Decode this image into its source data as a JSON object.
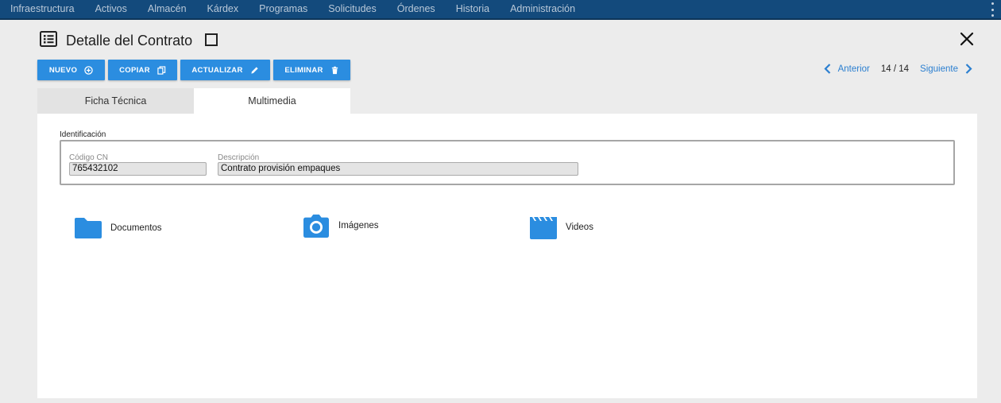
{
  "nav": {
    "items": [
      "Infraestructura",
      "Activos",
      "Almacén",
      "Kárdex",
      "Programas",
      "Solicitudes",
      "Órdenes",
      "Historia",
      "Administración"
    ]
  },
  "header": {
    "title": "Detalle del Contrato"
  },
  "toolbar": {
    "nuevo": "NUEVO",
    "copiar": "COPIAR",
    "actualizar": "ACTUALIZAR",
    "eliminar": "ELIMINAR"
  },
  "pager": {
    "prev": "Anterior",
    "count": "14 / 14",
    "next": "Siguiente"
  },
  "tabs": [
    {
      "label": "Ficha Técnica",
      "active": false
    },
    {
      "label": "Multimedia",
      "active": true
    }
  ],
  "identificacion": {
    "legend": "Identificación",
    "codigo_label": "Código CN",
    "codigo_value": "765432102",
    "descripcion_label": "Descripción",
    "descripcion_value": "Contrato provisión empaques"
  },
  "media": {
    "documentos": "Documentos",
    "imagenes": "Imágenes",
    "videos": "Videos"
  },
  "colors": {
    "accent": "#2b8de0",
    "nav_bg": "#134a7c",
    "link": "#2b7fd0"
  }
}
